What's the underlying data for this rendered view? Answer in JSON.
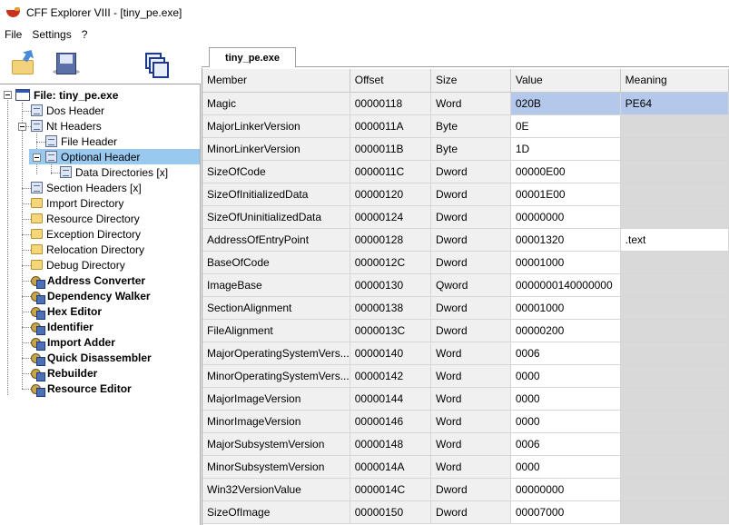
{
  "window": {
    "title": "CFF Explorer VIII - [tiny_pe.exe]"
  },
  "menu": [
    "File",
    "Settings",
    "?"
  ],
  "toolbar": {
    "open_icon": "open-file-icon",
    "save_icon": "save-disk-icon",
    "windows_icon": "windows-list-icon"
  },
  "tree": {
    "root": "File: tiny_pe.exe",
    "dos_header": "Dos Header",
    "nt_headers": "Nt Headers",
    "file_header": "File Header",
    "optional_header": "Optional Header",
    "data_directories": "Data Directories [x]",
    "section_headers": "Section Headers [x]",
    "import_directory": "Import Directory",
    "resource_directory": "Resource Directory",
    "exception_directory": "Exception Directory",
    "relocation_directory": "Relocation Directory",
    "debug_directory": "Debug Directory",
    "tools": [
      "Address Converter",
      "Dependency Walker",
      "Hex Editor",
      "Identifier",
      "Import Adder",
      "Quick Disassembler",
      "Rebuilder",
      "Resource Editor"
    ]
  },
  "tab": {
    "label": "tiny_pe.exe"
  },
  "table": {
    "columns": [
      "Member",
      "Offset",
      "Size",
      "Value",
      "Meaning"
    ],
    "rows": [
      {
        "member": "Magic",
        "offset": "00000118",
        "size": "Word",
        "value": "020B",
        "meaning": "PE64"
      },
      {
        "member": "MajorLinkerVersion",
        "offset": "0000011A",
        "size": "Byte",
        "value": "0E",
        "meaning": ""
      },
      {
        "member": "MinorLinkerVersion",
        "offset": "0000011B",
        "size": "Byte",
        "value": "1D",
        "meaning": ""
      },
      {
        "member": "SizeOfCode",
        "offset": "0000011C",
        "size": "Dword",
        "value": "00000E00",
        "meaning": ""
      },
      {
        "member": "SizeOfInitializedData",
        "offset": "00000120",
        "size": "Dword",
        "value": "00001E00",
        "meaning": ""
      },
      {
        "member": "SizeOfUninitializedData",
        "offset": "00000124",
        "size": "Dword",
        "value": "00000000",
        "meaning": ""
      },
      {
        "member": "AddressOfEntryPoint",
        "offset": "00000128",
        "size": "Dword",
        "value": "00001320",
        "meaning": ".text"
      },
      {
        "member": "BaseOfCode",
        "offset": "0000012C",
        "size": "Dword",
        "value": "00001000",
        "meaning": ""
      },
      {
        "member": "ImageBase",
        "offset": "00000130",
        "size": "Qword",
        "value": "0000000140000000",
        "meaning": ""
      },
      {
        "member": "SectionAlignment",
        "offset": "00000138",
        "size": "Dword",
        "value": "00001000",
        "meaning": ""
      },
      {
        "member": "FileAlignment",
        "offset": "0000013C",
        "size": "Dword",
        "value": "00000200",
        "meaning": ""
      },
      {
        "member": "MajorOperatingSystemVers...",
        "offset": "00000140",
        "size": "Word",
        "value": "0006",
        "meaning": ""
      },
      {
        "member": "MinorOperatingSystemVers...",
        "offset": "00000142",
        "size": "Word",
        "value": "0000",
        "meaning": ""
      },
      {
        "member": "MajorImageVersion",
        "offset": "00000144",
        "size": "Word",
        "value": "0000",
        "meaning": ""
      },
      {
        "member": "MinorImageVersion",
        "offset": "00000146",
        "size": "Word",
        "value": "0000",
        "meaning": ""
      },
      {
        "member": "MajorSubsystemVersion",
        "offset": "00000148",
        "size": "Word",
        "value": "0006",
        "meaning": ""
      },
      {
        "member": "MinorSubsystemVersion",
        "offset": "0000014A",
        "size": "Word",
        "value": "0000",
        "meaning": ""
      },
      {
        "member": "Win32VersionValue",
        "offset": "0000014C",
        "size": "Dword",
        "value": "00000000",
        "meaning": ""
      },
      {
        "member": "SizeOfImage",
        "offset": "00000150",
        "size": "Dword",
        "value": "00007000",
        "meaning": ""
      }
    ]
  },
  "colors": {
    "selection": "#99c9ef",
    "row_selection": "#b3c8ea"
  }
}
